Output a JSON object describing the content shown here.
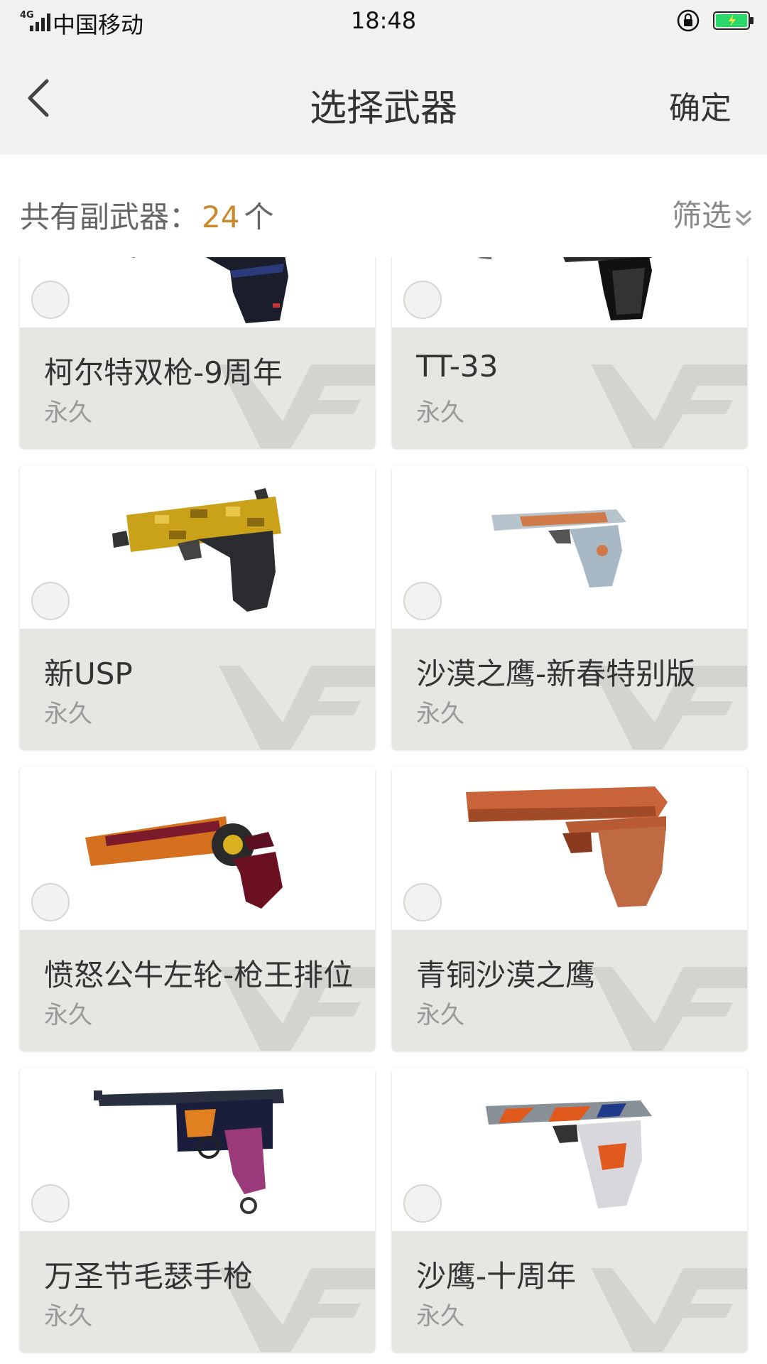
{
  "status_bar": {
    "network": "4G",
    "carrier": "中国移动",
    "time": "18:48"
  },
  "nav": {
    "title": "选择武器",
    "confirm_label": "确定"
  },
  "filter": {
    "count_prefix": "共有副武器：",
    "count_value": "24",
    "count_unit": "个",
    "filter_label": "筛选"
  },
  "colors": {
    "accent": "#c9882a",
    "header_bg": "#f2f1ef",
    "card_info_bg": "#e8e6e3"
  },
  "weapons": [
    {
      "name": "柯尔特双枪-9周年",
      "duration": "永久",
      "icon": "dual-pistol-icon"
    },
    {
      "name": "TT-33",
      "duration": "永久",
      "icon": "pistol-icon"
    },
    {
      "name": "新USP",
      "duration": "永久",
      "icon": "gold-camo-pistol-icon"
    },
    {
      "name": "沙漠之鹰-新春特别版",
      "duration": "永久",
      "icon": "desert-eagle-icon"
    },
    {
      "name": "愤怒公牛左轮-枪王排位",
      "duration": "永久",
      "icon": "revolver-icon"
    },
    {
      "name": "青铜沙漠之鹰",
      "duration": "永久",
      "icon": "bronze-desert-eagle-icon"
    },
    {
      "name": "万圣节毛瑟手枪",
      "duration": "永久",
      "icon": "halloween-mauser-icon"
    },
    {
      "name": "沙鹰-十周年",
      "duration": "永久",
      "icon": "desert-eagle-anniversary-icon"
    }
  ]
}
